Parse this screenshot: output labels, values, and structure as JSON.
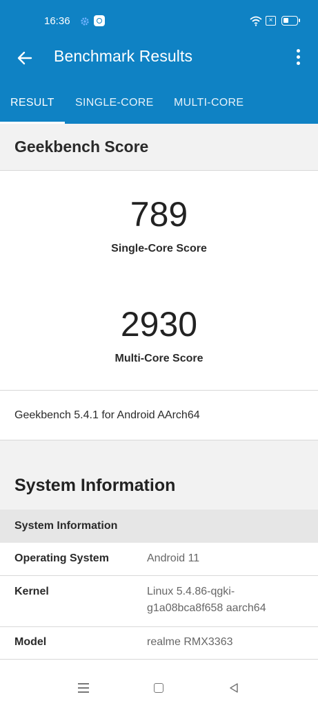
{
  "status_bar": {
    "time": "16:36",
    "icons": [
      "gear-icon",
      "app-notification-icon",
      "wifi-icon",
      "data-off-icon",
      "battery-icon"
    ]
  },
  "app_bar": {
    "title": "Benchmark Results",
    "back_icon": "arrow-left-icon",
    "menu_icon": "more-vertical-icon"
  },
  "tabs": [
    {
      "label": "RESULT",
      "active": true
    },
    {
      "label": "SINGLE-CORE",
      "active": false
    },
    {
      "label": "MULTI-CORE",
      "active": false
    }
  ],
  "score_section": {
    "heading": "Geekbench Score",
    "single_core": {
      "value": "789",
      "label": "Single-Core Score"
    },
    "multi_core": {
      "value": "2930",
      "label": "Multi-Core Score"
    },
    "version": "Geekbench 5.4.1 for Android AArch64"
  },
  "system_section": {
    "heading": "System Information",
    "subheading": "System Information",
    "rows": [
      {
        "key": "Operating System",
        "value": "Android 11"
      },
      {
        "key": "Kernel",
        "value": "Linux 5.4.86-qgki-g1a08bca8f658 aarch64"
      },
      {
        "key": "Model",
        "value": "realme RMX3363"
      }
    ]
  },
  "nav_bar": {
    "icons": [
      "menu-icon",
      "home-icon",
      "back-triangle-icon"
    ]
  },
  "colors": {
    "accent": "#0f82c4",
    "section_bg": "#f2f2f2",
    "subheader_bg": "#e6e6e6"
  }
}
